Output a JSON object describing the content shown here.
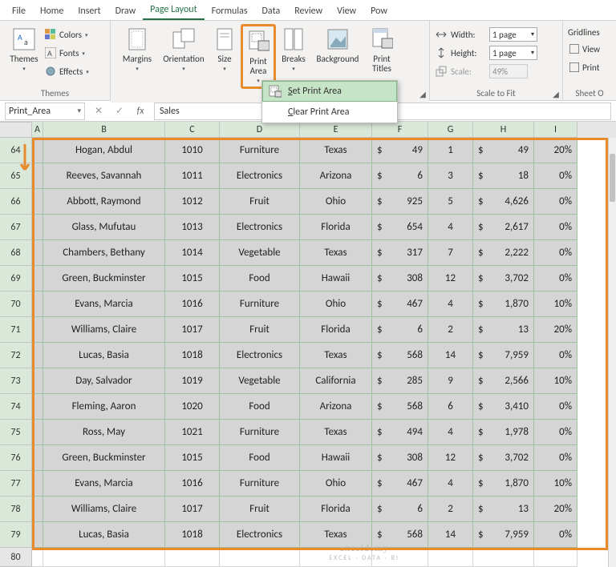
{
  "tabs": [
    "File",
    "Home",
    "Insert",
    "Draw",
    "Page Layout",
    "Formulas",
    "Data",
    "Review",
    "View",
    "Pow"
  ],
  "active_tab_index": 4,
  "ribbon": {
    "themes": {
      "label": "Themes",
      "btn": "Themes",
      "colors": "Colors",
      "fonts": "Fonts",
      "effects": "Effects"
    },
    "page_setup": {
      "label": "Pag",
      "margins": "Margins",
      "orientation": "Orientation",
      "size": "Size",
      "print_area": "Print\nArea",
      "breaks": "Breaks",
      "background": "Background",
      "print_titles": "Print\nTitles"
    },
    "scale": {
      "label": "Scale to Fit",
      "width": "Width:",
      "height": "Height:",
      "scale": "Scale:",
      "width_val": "1 page",
      "height_val": "1 page",
      "scale_val": "49%"
    },
    "sheet_options": {
      "label": "Sheet O",
      "gridlines": "Gridlines",
      "view": "View",
      "print": "Print"
    }
  },
  "dropdown": {
    "set": "Set Print Area",
    "clear": "Clear Print Area"
  },
  "namebox": "Print_Area",
  "formula": "Sales",
  "columns": [
    "A",
    "B",
    "C",
    "D",
    "E",
    "F",
    "G",
    "H",
    "I"
  ],
  "row_start": 64,
  "data": [
    {
      "r": 64,
      "b": "Hogan, Abdul",
      "c": 1010,
      "d": "Furniture",
      "e": "Texas",
      "f": 49,
      "g": 1,
      "h": 49,
      "i": "20%"
    },
    {
      "r": 65,
      "b": "Reeves, Savannah",
      "c": 1011,
      "d": "Electronics",
      "e": "Arizona",
      "f": 6,
      "g": 3,
      "h": 18,
      "i": "0%"
    },
    {
      "r": 66,
      "b": "Abbott, Raymond",
      "c": 1012,
      "d": "Fruit",
      "e": "Ohio",
      "f": 925,
      "g": 5,
      "h": "4,626",
      "i": "0%"
    },
    {
      "r": 67,
      "b": "Glass, Mufutau",
      "c": 1013,
      "d": "Electronics",
      "e": "Florida",
      "f": 654,
      "g": 4,
      "h": "2,617",
      "i": "0%"
    },
    {
      "r": 68,
      "b": "Chambers, Bethany",
      "c": 1014,
      "d": "Vegetable",
      "e": "Texas",
      "f": 317,
      "g": 7,
      "h": "2,222",
      "i": "0%"
    },
    {
      "r": 69,
      "b": "Green, Buckminster",
      "c": 1015,
      "d": "Food",
      "e": "Hawaii",
      "f": 308,
      "g": 12,
      "h": "3,702",
      "i": "0%"
    },
    {
      "r": 70,
      "b": "Evans, Marcia",
      "c": 1016,
      "d": "Furniture",
      "e": "Ohio",
      "f": 467,
      "g": 4,
      "h": "1,870",
      "i": "10%"
    },
    {
      "r": 71,
      "b": "Williams, Claire",
      "c": 1017,
      "d": "Fruit",
      "e": "Florida",
      "f": 6,
      "g": 2,
      "h": 13,
      "i": "20%"
    },
    {
      "r": 72,
      "b": "Lucas, Basia",
      "c": 1018,
      "d": "Electronics",
      "e": "Texas",
      "f": 568,
      "g": 14,
      "h": "7,959",
      "i": "0%"
    },
    {
      "r": 73,
      "b": "Day, Salvador",
      "c": 1019,
      "d": "Vegetable",
      "e": "California",
      "f": 285,
      "g": 9,
      "h": "2,566",
      "i": "10%"
    },
    {
      "r": 74,
      "b": "Fleming, Aaron",
      "c": 1020,
      "d": "Food",
      "e": "Arizona",
      "f": 568,
      "g": 6,
      "h": "3,410",
      "i": "0%"
    },
    {
      "r": 75,
      "b": "Ross, May",
      "c": 1021,
      "d": "Furniture",
      "e": "Texas",
      "f": 494,
      "g": 4,
      "h": "1,978",
      "i": "0%"
    },
    {
      "r": 76,
      "b": "Green, Buckminster",
      "c": 1015,
      "d": "Food",
      "e": "Hawaii",
      "f": 308,
      "g": 12,
      "h": "3,702",
      "i": "0%"
    },
    {
      "r": 77,
      "b": "Evans, Marcia",
      "c": 1016,
      "d": "Furniture",
      "e": "Ohio",
      "f": 467,
      "g": 4,
      "h": "1,870",
      "i": "10%"
    },
    {
      "r": 78,
      "b": "Williams, Claire",
      "c": 1017,
      "d": "Fruit",
      "e": "Florida",
      "f": 6,
      "g": 2,
      "h": 13,
      "i": "20%"
    },
    {
      "r": 79,
      "b": "Lucas, Basia",
      "c": 1018,
      "d": "Electronics",
      "e": "Texas",
      "f": 568,
      "g": 14,
      "h": "7,959",
      "i": "0%"
    }
  ],
  "blank_row": 80,
  "watermark": {
    "main": "exceldemy",
    "sub": "EXCEL · DATA · BI"
  }
}
